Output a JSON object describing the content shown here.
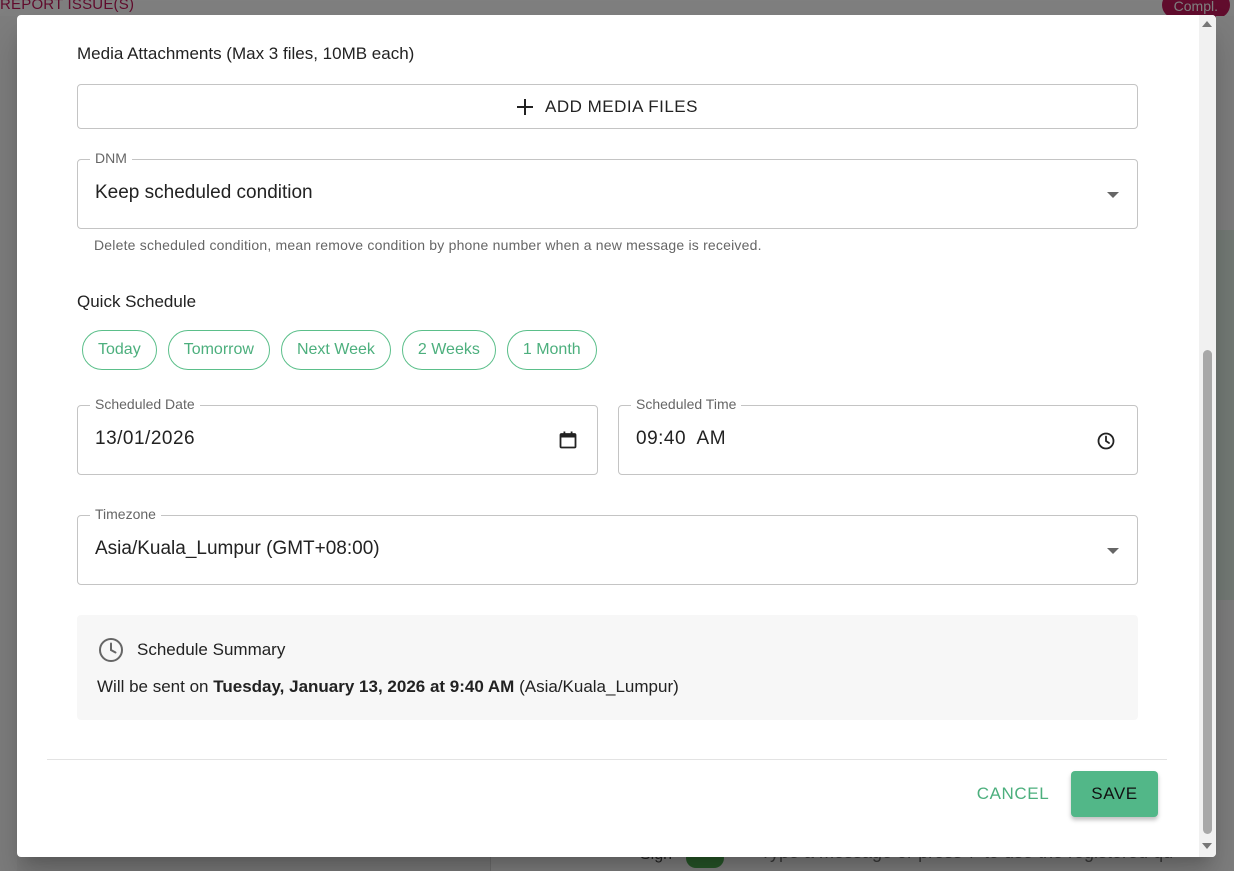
{
  "background": {
    "report_label": "REPORT ISSUE(S)",
    "compl_badge": "Compl.",
    "composer_placeholder": "Type a message or press '/' to use the registered qu",
    "sign_label": "Sign"
  },
  "media": {
    "label": "Media Attachments (Max 3 files, 10MB each)",
    "add_button": "ADD MEDIA FILES"
  },
  "dnm": {
    "label": "DNM",
    "value": "Keep scheduled condition",
    "helper": "Delete scheduled condition, mean remove condition by phone number when a new message is received."
  },
  "quick_schedule": {
    "title": "Quick Schedule",
    "options": [
      "Today",
      "Tomorrow",
      "Next Week",
      "2 Weeks",
      "1 Month"
    ]
  },
  "scheduled_date": {
    "label": "Scheduled Date",
    "value": "13/01/2026"
  },
  "scheduled_time": {
    "label": "Scheduled Time",
    "value": "09:40  AM"
  },
  "timezone": {
    "label": "Timezone",
    "value": "Asia/Kuala_Lumpur (GMT+08:00)"
  },
  "summary": {
    "title": "Schedule Summary",
    "prefix": "Will be sent on ",
    "datetime": "Tuesday, January 13, 2026 at 9:40 AM",
    "suffix": " (Asia/Kuala_Lumpur)"
  },
  "actions": {
    "cancel": "CANCEL",
    "save": "SAVE"
  },
  "colors": {
    "accent": "#52b788",
    "chip_text": "#4caf7d"
  }
}
